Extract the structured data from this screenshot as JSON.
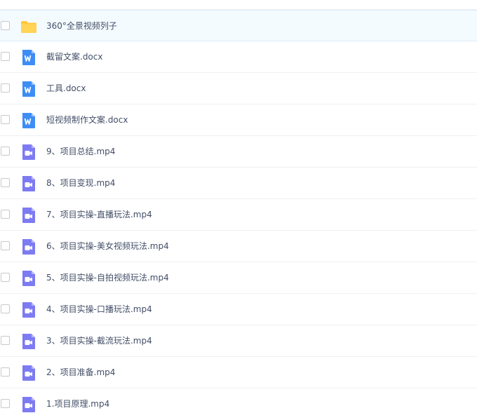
{
  "files": [
    {
      "name": "360°全景视频列子",
      "type": "folder",
      "selected": true
    },
    {
      "name": "截留文案.docx",
      "type": "word",
      "selected": false
    },
    {
      "name": "工具.docx",
      "type": "word",
      "selected": false
    },
    {
      "name": "短视频制作文案.docx",
      "type": "word",
      "selected": false
    },
    {
      "name": "9、项目总结.mp4",
      "type": "video",
      "selected": false
    },
    {
      "name": "8、项目变现.mp4",
      "type": "video",
      "selected": false
    },
    {
      "name": "7、项目实操-直播玩法.mp4",
      "type": "video",
      "selected": false
    },
    {
      "name": "6、项目实操-美女视频玩法.mp4",
      "type": "video",
      "selected": false
    },
    {
      "name": "5、项目实操-自拍视频玩法.mp4",
      "type": "video",
      "selected": false
    },
    {
      "name": "4、项目实操-口播玩法.mp4",
      "type": "video",
      "selected": false
    },
    {
      "name": "3、项目实操-截流玩法.mp4",
      "type": "video",
      "selected": false
    },
    {
      "name": "2、项目准备.mp4",
      "type": "video",
      "selected": false
    },
    {
      "name": "1.项目原理.mp4",
      "type": "video",
      "selected": false
    }
  ],
  "icons": {
    "folder": {
      "name": "folder-icon",
      "color": "#FFCA3A"
    },
    "word": {
      "name": "word-doc-icon",
      "color": "#3E8DF5"
    },
    "video": {
      "name": "video-file-icon",
      "color": "#7D7BF2"
    }
  }
}
